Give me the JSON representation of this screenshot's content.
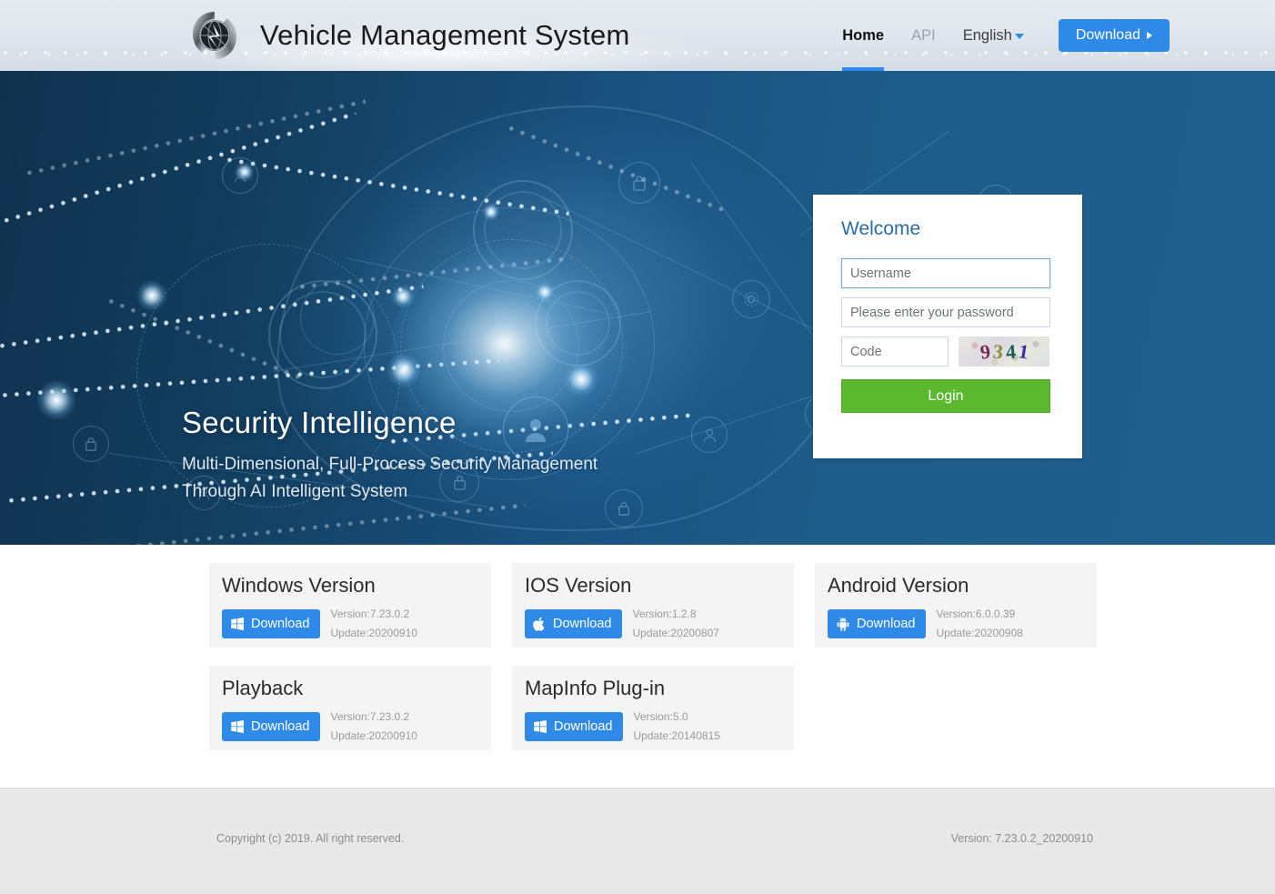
{
  "header": {
    "logo_icon": "globe-emblem-logo",
    "title": "Vehicle Management System",
    "nav": [
      {
        "label": "Home",
        "state": "active"
      },
      {
        "label": "API",
        "state": "muted"
      },
      {
        "label": "English",
        "state": "dropdown"
      }
    ],
    "download_button": "Download",
    "download_caret_icon": "triangle-right-icon",
    "lang_caret_icon": "chevron-down-icon",
    "accent_color": "#2e8ae6"
  },
  "hero": {
    "headline": "Security Intelligence",
    "subline_1": "Multi-Dimensional, Full-Process Security Management",
    "subline_2": "Through AI Intelligent System",
    "carousel": {
      "count": 3,
      "active_index": 0
    },
    "background_color_dark": "#10314e",
    "background_color_light": "#20608e"
  },
  "login": {
    "title": "Welcome",
    "username_placeholder": "Username",
    "username_value": "",
    "password_placeholder": "Please enter your password",
    "password_value": "",
    "code_placeholder": "Code",
    "code_value": "",
    "captcha_text": "9341",
    "captcha_chars": [
      "9",
      "3",
      "4",
      "1"
    ],
    "captcha_colors": [
      "#7a2b4e",
      "#8a8a38",
      "#1f5a5a",
      "#3a2fa8"
    ],
    "login_button": "Login",
    "login_button_color": "#5cb82e"
  },
  "downloads": {
    "cards": [
      {
        "title": "Windows Version",
        "button": "Download",
        "icon": "windows-logo-icon",
        "version": "Version:7.23.0.2",
        "update": "Update:20200910"
      },
      {
        "title": "IOS Version",
        "button": "Download",
        "icon": "apple-logo-icon",
        "version": "Version:1.2.8",
        "update": "Update:20200807"
      },
      {
        "title": "Android Version",
        "button": "Download",
        "icon": "android-logo-icon",
        "version": "Version:6.0.0.39",
        "update": "Update:20200908"
      },
      {
        "title": "Playback",
        "button": "Download",
        "icon": "windows-logo-icon",
        "version": "Version:7.23.0.2",
        "update": "Update:20200910"
      },
      {
        "title": "MapInfo Plug-in",
        "button": "Download",
        "icon": "windows-logo-icon",
        "version": "Version:5.0",
        "update": "Update:20140815"
      }
    ]
  },
  "footer": {
    "copyright": "Copyright (c) 2019. All right reserved.",
    "version": "Version: 7.23.0.2_20200910"
  }
}
